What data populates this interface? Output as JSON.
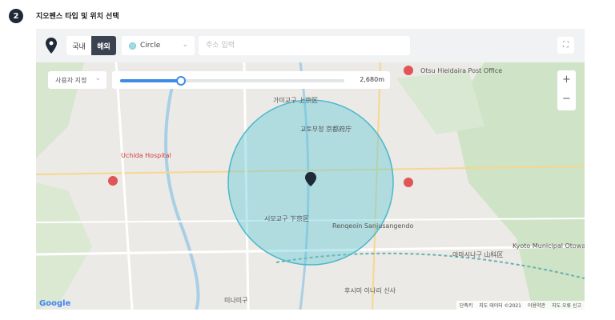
{
  "step": {
    "number": "2",
    "title": "지오펜스 타입 및 위치 선택"
  },
  "toolbar": {
    "region": {
      "domestic": "국내",
      "overseas": "해외",
      "selected": "해외"
    },
    "shape": {
      "value": "Circle",
      "color": "#9fdbe8"
    },
    "address": {
      "value": "",
      "placeholder": "주소 입력"
    }
  },
  "map": {
    "mode_select": "사용자 지정",
    "radius": {
      "label": "2,680m",
      "fraction": 0.27
    },
    "zoom_in": "+",
    "zoom_out": "−",
    "labels": [
      "가미교구 上京区",
      "교토부청 京都府庁",
      "시모교구 下京区",
      "야마시나구 山科区",
      "Uchida Hospital",
      "Otsu Hieidaira Post Office",
      "Kyoto Municipal Otowa JHS",
      "Renqeoin Sanjusangendo",
      "미나미구",
      "후시미 이나리 신사"
    ],
    "google": "Google",
    "attribution": [
      "단축키",
      "지도 데이터 ©2021",
      "이용약관",
      "지도 오류 신고"
    ]
  }
}
